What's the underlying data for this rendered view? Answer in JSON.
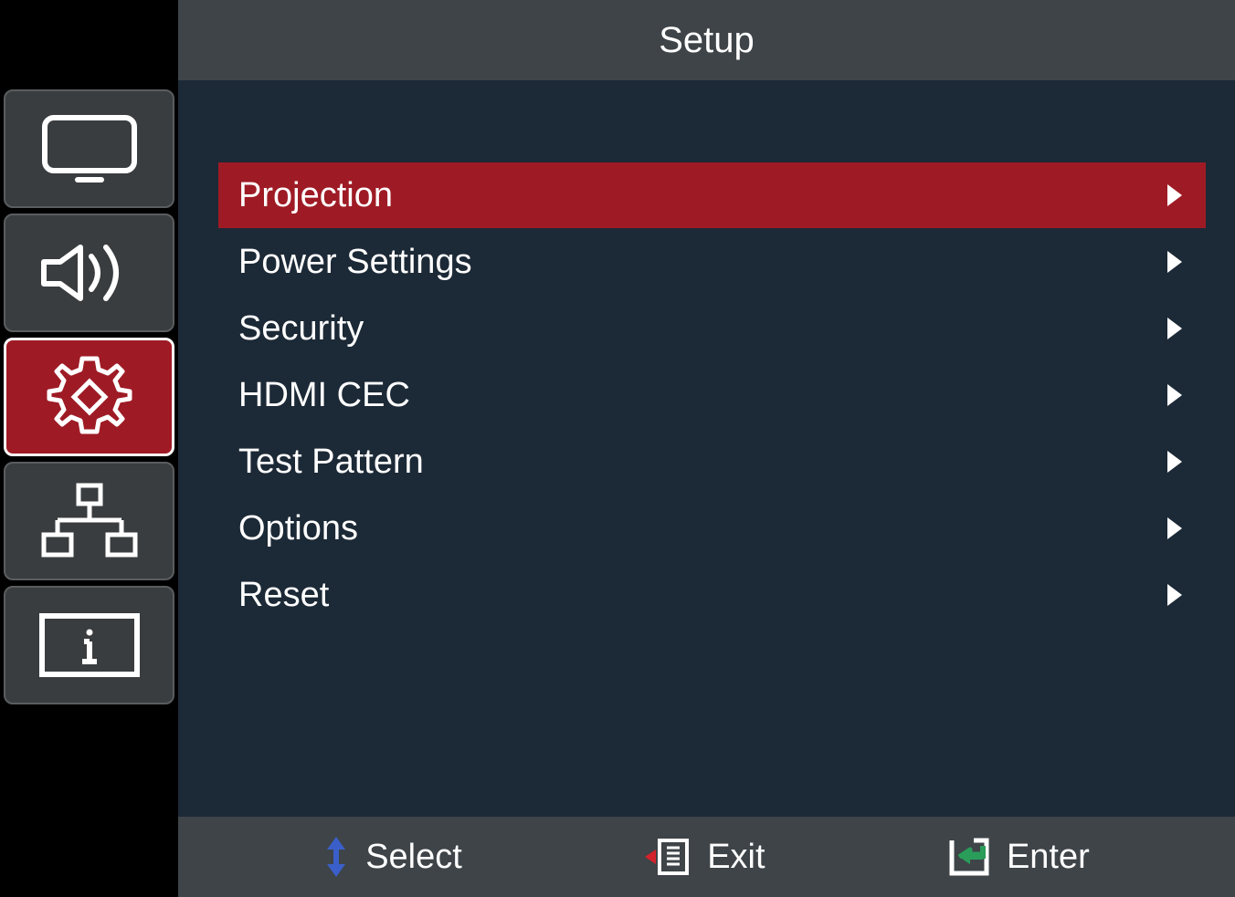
{
  "header": {
    "title": "Setup"
  },
  "sidebar": {
    "items": [
      {
        "id": "display",
        "active": false
      },
      {
        "id": "audio",
        "active": false
      },
      {
        "id": "setup",
        "active": true
      },
      {
        "id": "network",
        "active": false
      },
      {
        "id": "info",
        "active": false
      }
    ]
  },
  "menu": {
    "items": [
      {
        "label": "Projection",
        "selected": true
      },
      {
        "label": "Power Settings",
        "selected": false
      },
      {
        "label": "Security",
        "selected": false
      },
      {
        "label": "HDMI CEC",
        "selected": false
      },
      {
        "label": "Test Pattern",
        "selected": false
      },
      {
        "label": "Options",
        "selected": false
      },
      {
        "label": "Reset",
        "selected": false
      }
    ]
  },
  "footer": {
    "select_label": "Select",
    "exit_label": "Exit",
    "enter_label": "Enter"
  }
}
